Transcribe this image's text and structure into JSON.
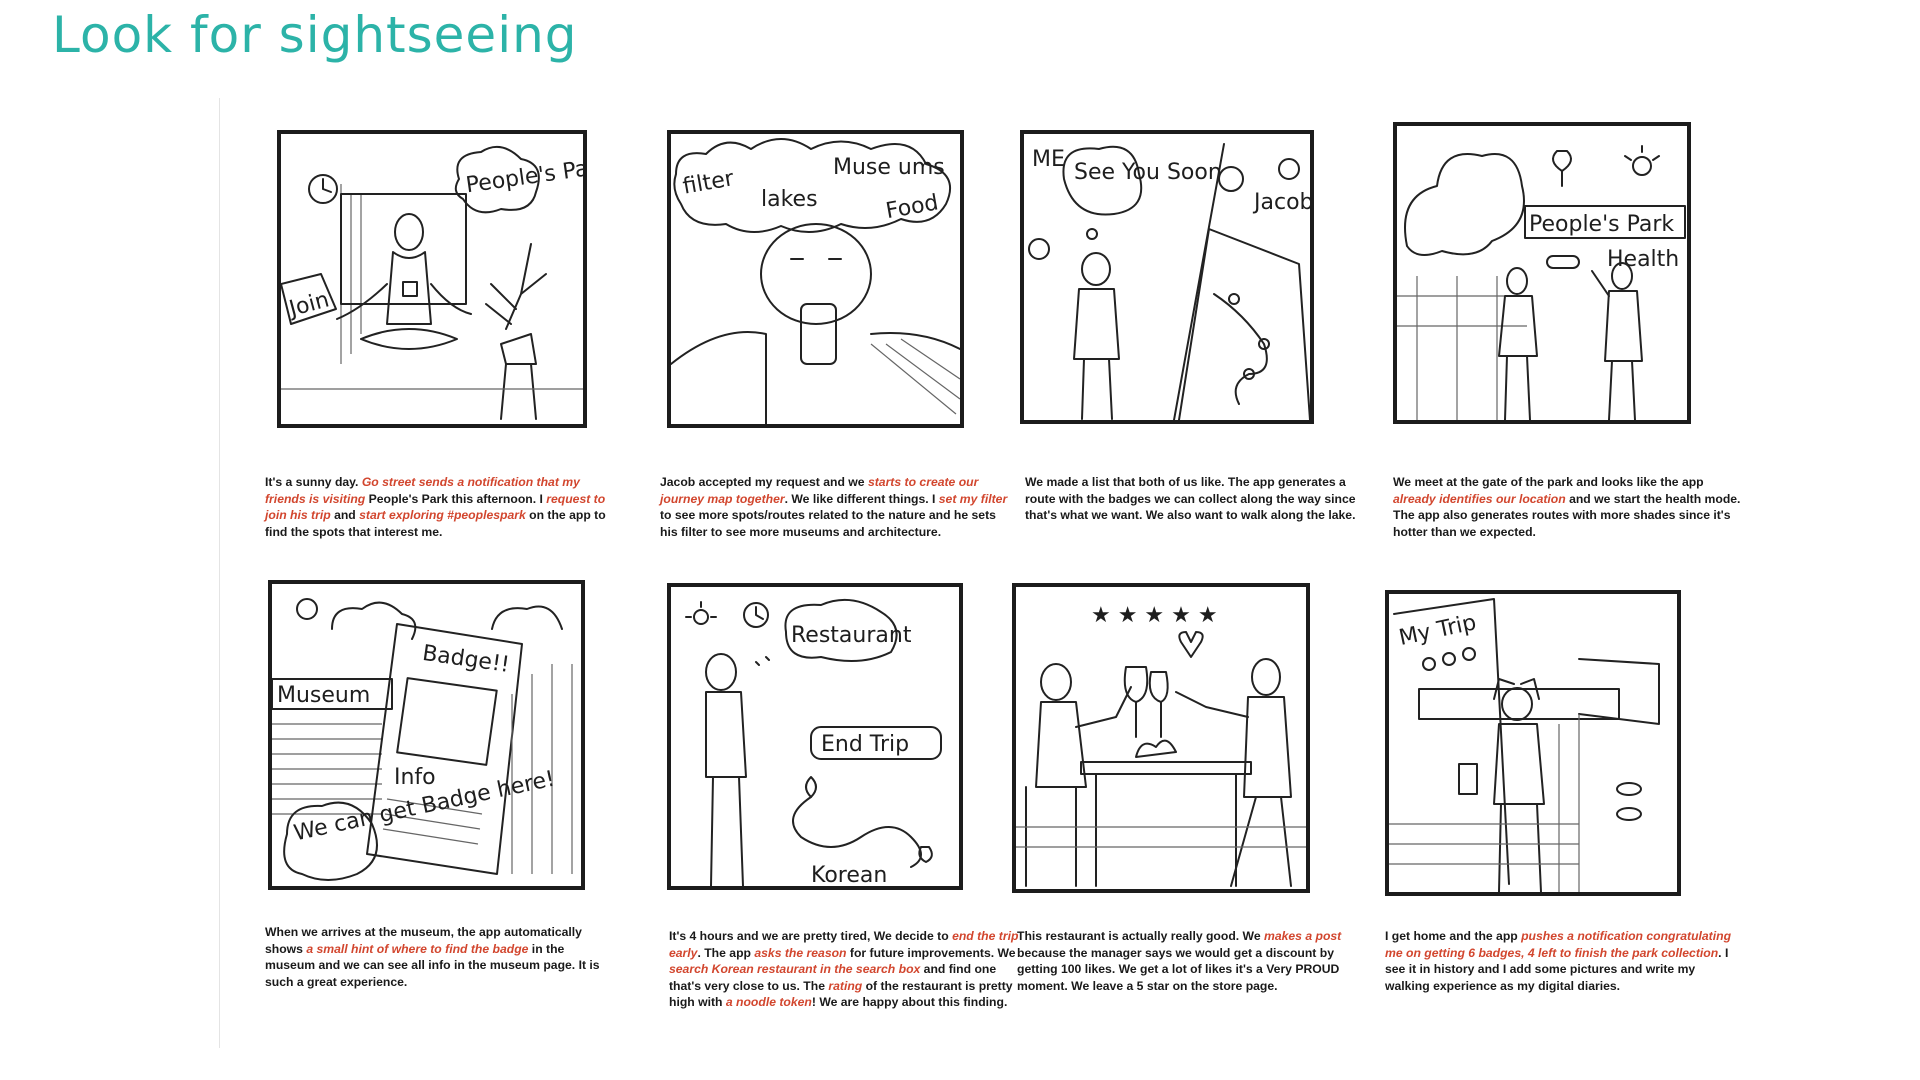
{
  "title": "Look for sightseeing",
  "colors": {
    "title": "#2cb3a8",
    "highlight": "#d2462e",
    "text": "#1a1a1a"
  },
  "panels": [
    {
      "sketch_labels": [
        "People's Park",
        "Join"
      ],
      "caption": [
        {
          "t": "It's a sunny day. "
        },
        {
          "t": "Go street sends a notification that my friends is visiting",
          "h": true
        },
        {
          "t": " People's Park this afternoon. I "
        },
        {
          "t": "request to join his trip",
          "h": true
        },
        {
          "t": " and "
        },
        {
          "t": "start exploring #peoplespark",
          "h": true
        },
        {
          "t": " on the app to find the spots that interest me."
        }
      ]
    },
    {
      "sketch_labels": [
        "filter",
        "lakes",
        "Muse ums",
        "Food"
      ],
      "caption": [
        {
          "t": "Jacob accepted my request and we "
        },
        {
          "t": "starts to create our journey map together",
          "h": true
        },
        {
          "t": ". We like different things. I "
        },
        {
          "t": "set my filter",
          "h": true
        },
        {
          "t": " to see more spots/routes related to the nature and he sets his filter to see more museums and architecture."
        }
      ]
    },
    {
      "sketch_labels": [
        "ME",
        "See You Soon",
        "Jacob"
      ],
      "caption": [
        {
          "t": "We made a list that both of us like. The app generates a route with the badges we can collect along the way since that's what we want. We also want to walk along the lake."
        }
      ]
    },
    {
      "sketch_labels": [
        "People's Park",
        "Health"
      ],
      "caption": [
        {
          "t": "We meet at the gate of the park and looks like the app "
        },
        {
          "t": "already identifies our location",
          "h": true
        },
        {
          "t": " and we start the health mode. The app also generates routes with more shades since it's hotter than we expected."
        }
      ]
    },
    {
      "sketch_labels": [
        "Museum",
        "Badge!!",
        "Info",
        "We can get Badge here!"
      ],
      "caption": [
        {
          "t": "When we arrives at the museum, the app automatically shows "
        },
        {
          "t": "a small hint of where to find the badge",
          "h": true
        },
        {
          "t": " in the museum and we can see all info in the museum page. It is such a great experience."
        }
      ]
    },
    {
      "sketch_labels": [
        "Restaurant",
        "End Trip",
        "Korean"
      ],
      "caption": [
        {
          "t": "It's 4 hours and we are pretty tired, We decide to "
        },
        {
          "t": "end the trip early",
          "h": true
        },
        {
          "t": ". The app "
        },
        {
          "t": "asks the reason",
          "h": true
        },
        {
          "t": " for future improvements. We "
        },
        {
          "t": "search Korean restaurant in the search box",
          "h": true
        },
        {
          "t": " and find one that's very close to us. The "
        },
        {
          "t": "rating",
          "h": true
        },
        {
          "t": " of the restaurant is pretty high with "
        },
        {
          "t": "a noodle token",
          "h": true
        },
        {
          "t": "! We are happy about this finding."
        }
      ]
    },
    {
      "sketch_labels": [
        "★ ★ ★ ★ ★"
      ],
      "caption": [
        {
          "t": "This restaurant is actually really good. We "
        },
        {
          "t": "makes a post",
          "h": true
        },
        {
          "t": " because the manager says we would get a discount by getting 100 likes. We get a lot of likes it's a Very PROUD moment. We leave a 5 star on the store page."
        }
      ]
    },
    {
      "sketch_labels": [
        "My Trip"
      ],
      "caption": [
        {
          "t": "I get home and the app "
        },
        {
          "t": "pushes a notification congratulating me on getting 6 badges, 4 left to finish the park collection",
          "h": true
        },
        {
          "t": ". I see it in history and I add some pictures and write my walking experience as my digital diaries."
        }
      ]
    }
  ]
}
